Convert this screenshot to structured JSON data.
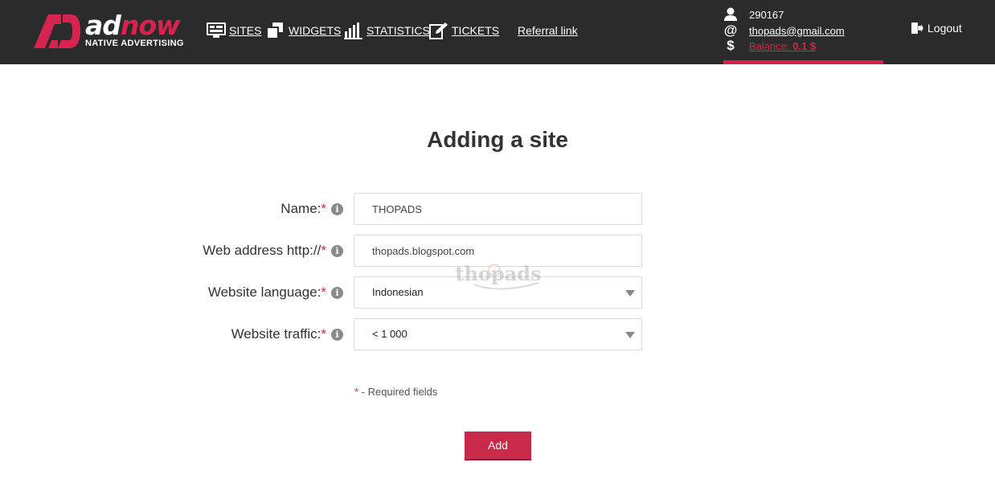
{
  "brand": {
    "logo_word_white": "ad",
    "logo_word_red": "now",
    "tagline": "NATIVE ADVERTISING",
    "accent_color": "#d7234f",
    "header_bg": "#2b2b2b"
  },
  "nav": {
    "items": [
      {
        "label": "SITES",
        "icon": "monitor-icon"
      },
      {
        "label": "WIDGETS",
        "icon": "widgets-icon"
      },
      {
        "label": "STATISTICS",
        "icon": "bar-chart-icon"
      },
      {
        "label": "TICKETS",
        "icon": "edit-ticket-icon"
      },
      {
        "label": "Referral link",
        "icon": null
      }
    ]
  },
  "user": {
    "id": "290167",
    "email": "thopads@gmail.com",
    "balance_label": "Balance: ",
    "balance_value": "0.1 $"
  },
  "logout_label": "Logout",
  "page": {
    "title": "Adding a site"
  },
  "form": {
    "name": {
      "label": "Name:",
      "required_mark": "*",
      "value": "THOPADS"
    },
    "web_address": {
      "label": "Web address http://",
      "required_mark": "*",
      "value": "thopads.blogspot.com"
    },
    "language": {
      "label": "Website language:",
      "required_mark": "*",
      "selected": "Indonesian"
    },
    "traffic": {
      "label": "Website traffic:",
      "required_mark": "*",
      "selected": "< 1 000"
    },
    "info_glyph": "i",
    "required_note_mark": "*",
    "required_note_text": " - Required fields",
    "submit_label": "Add"
  },
  "watermark_text": "thopads"
}
